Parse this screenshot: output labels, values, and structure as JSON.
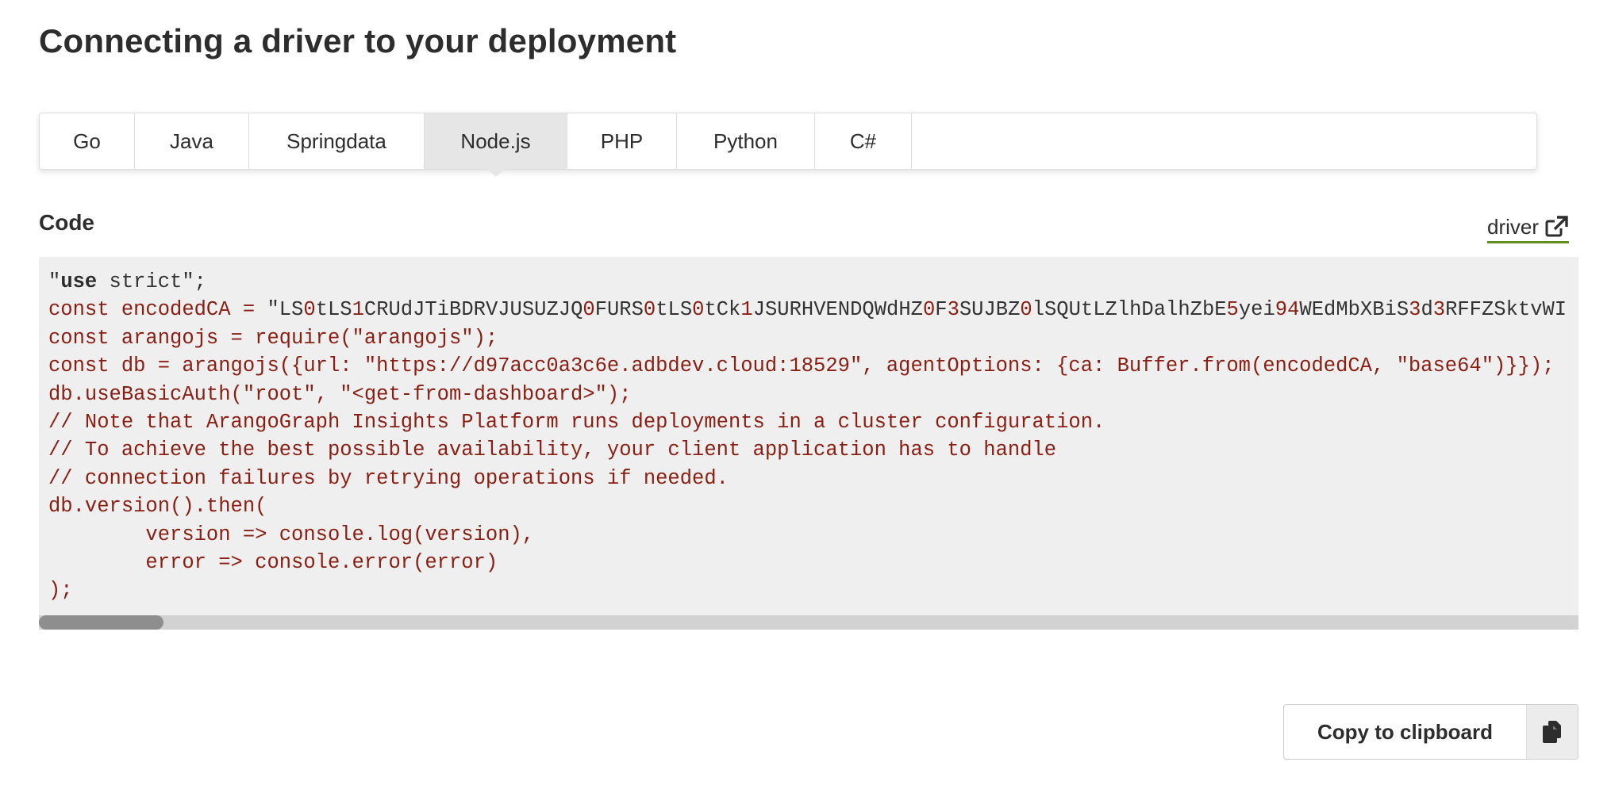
{
  "page": {
    "title": "Connecting a driver to your deployment"
  },
  "tabs": [
    {
      "label": "Go",
      "active": false
    },
    {
      "label": "Java",
      "active": false
    },
    {
      "label": "Springdata",
      "active": false
    },
    {
      "label": "Node.js",
      "active": true
    },
    {
      "label": "PHP",
      "active": false
    },
    {
      "label": "Python",
      "active": false
    },
    {
      "label": "C#",
      "active": false
    }
  ],
  "code_section": {
    "label": "Code",
    "driver_link_label": "driver",
    "driver_link_icon": "external-link-icon",
    "lines": [
      "\"use strict\";",
      "const encodedCA = \"LS0tLS1CRUdJTiBDRVJUSUZJQ0FURS0tLS0tCk1JSURHVENDQWdHZ0F3SUJBZ0lSQUtLZlhDalhZbE5yei94WEdMbXBiS3d3RFFZSktvWI",
      "const arangojs = require(\"arangojs\");",
      "const db = arangojs({url: \"https://d97acc0a3c6e.adbdev.cloud:18529\", agentOptions: {ca: Buffer.from(encodedCA, \"base64\")}});",
      "db.useBasicAuth(\"root\", \"<get-from-dashboard>\");",
      "// Note that ArangoGraph Insights Platform runs deployments in a cluster configuration.",
      "// To achieve the best possible availability, your client application has to handle",
      "// connection failures by retrying operations if needed.",
      "db.version().then(",
      "        version => console.log(version),",
      "        error => console.error(error)",
      ");"
    ],
    "scroll_position_fraction": 0.0
  },
  "copy_button": {
    "label": "Copy to clipboard",
    "icon": "clipboard-icon"
  },
  "colors": {
    "code_background": "#efefef",
    "code_accent_red": "#8a1e12",
    "active_tab": "#e6e6e6",
    "link_underline": "#5f8f1f"
  }
}
